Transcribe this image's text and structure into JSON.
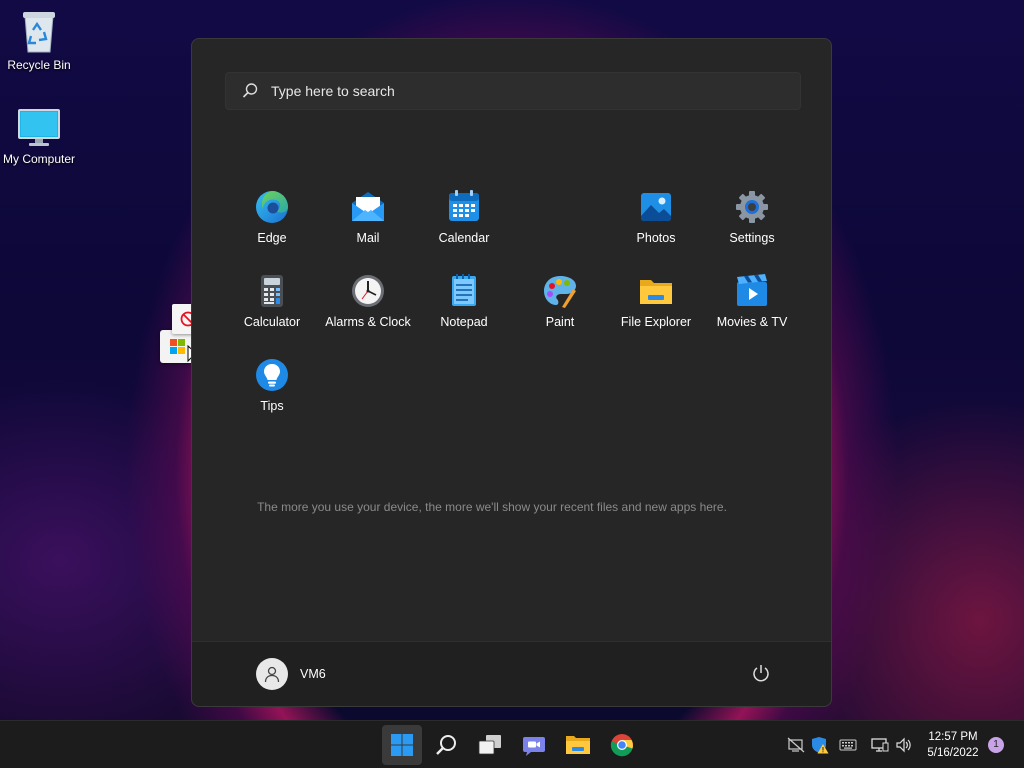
{
  "desktop": {
    "icons": [
      {
        "label": "Recycle Bin",
        "icon": "recycle-bin-icon"
      },
      {
        "label": "My Computer",
        "icon": "monitor-icon"
      }
    ],
    "drag_item": {
      "icon": "microsoft-store-icon",
      "overlay": "no-drop-icon"
    }
  },
  "start_menu": {
    "search_placeholder": "Type here to search",
    "apps": [
      {
        "label": "Edge",
        "icon": "edge-icon"
      },
      {
        "label": "Mail",
        "icon": "mail-icon"
      },
      {
        "label": "Calendar",
        "icon": "calendar-icon"
      },
      {
        "label": "Photos",
        "icon": "photos-icon"
      },
      {
        "label": "Settings",
        "icon": "gear-icon"
      },
      {
        "label": "Calculator",
        "icon": "calculator-icon"
      },
      {
        "label": "Alarms & Clock",
        "icon": "clock-icon"
      },
      {
        "label": "Notepad",
        "icon": "notepad-icon"
      },
      {
        "label": "Paint",
        "icon": "paint-palette-icon"
      },
      {
        "label": "File Explorer",
        "icon": "folder-icon"
      },
      {
        "label": "Movies & TV",
        "icon": "movie-icon"
      },
      {
        "label": "Tips",
        "icon": "lightbulb-icon"
      }
    ],
    "recommended_message": "The more you use your device, the more we'll show your recent files and new apps here.",
    "user": {
      "name": "VM6"
    }
  },
  "taskbar": {
    "pinned": [
      {
        "name": "start",
        "icon": "windows-logo-icon",
        "active": true
      },
      {
        "name": "search",
        "icon": "search-icon"
      },
      {
        "name": "task-view",
        "icon": "task-view-icon"
      },
      {
        "name": "chat",
        "icon": "teams-chat-icon"
      },
      {
        "name": "file-explorer",
        "icon": "folder-icon"
      },
      {
        "name": "chrome",
        "icon": "chrome-icon"
      }
    ],
    "tray": [
      "network-off-icon",
      "security-warning-icon",
      "keyboard-icon",
      "display-icon",
      "volume-icon"
    ],
    "time": "12:57 PM",
    "date": "5/16/2022",
    "notification_count": "1"
  },
  "colors": {
    "start_bg": "#262626",
    "taskbar_bg": "#1c1c1c",
    "accent_blue": "#0078d4"
  }
}
